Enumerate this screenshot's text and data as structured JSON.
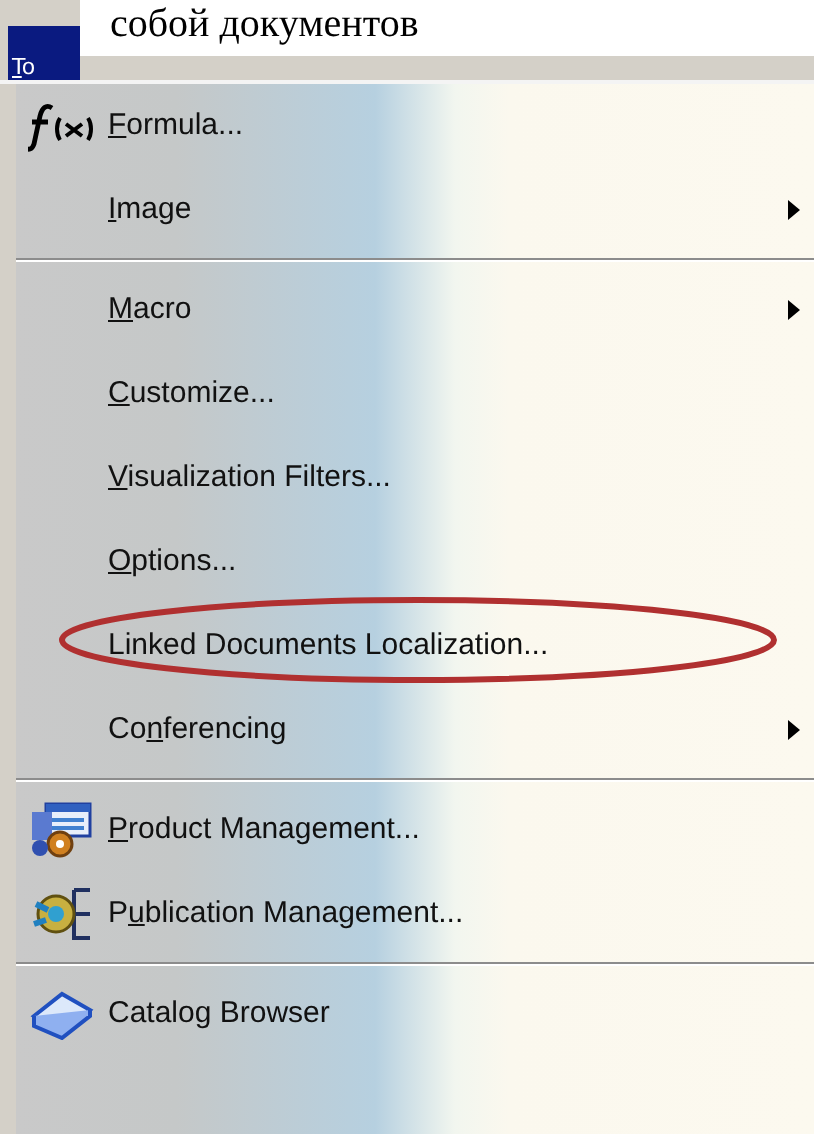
{
  "caption": "собой документов",
  "menu_bar": {
    "title": {
      "key": "T",
      "post": "o"
    },
    "open": true
  },
  "menu_items": [
    {
      "kind": "item",
      "key": "F",
      "post": "ormula...",
      "submenu": false,
      "highlighted": false
    },
    {
      "kind": "item",
      "key": "I",
      "post": "mage",
      "submenu": true,
      "highlighted": false
    },
    {
      "kind": "separator"
    },
    {
      "kind": "item",
      "key": "M",
      "post": "acro",
      "submenu": true,
      "highlighted": false
    },
    {
      "kind": "item",
      "key": "C",
      "post": "ustomize...",
      "submenu": false,
      "highlighted": false
    },
    {
      "kind": "item",
      "key": "V",
      "post": "isualization Filters...",
      "submenu": false,
      "highlighted": false
    },
    {
      "kind": "item",
      "key": "O",
      "post": "ptions...",
      "submenu": false,
      "highlighted": false
    },
    {
      "kind": "item",
      "pre": "Linked Documents Localization...",
      "submenu": false,
      "highlighted": true
    },
    {
      "kind": "item",
      "pre": "Co",
      "key": "n",
      "post": "ferencing",
      "submenu": true,
      "highlighted": false
    },
    {
      "kind": "separator"
    },
    {
      "kind": "item",
      "key": "P",
      "post": "roduct Management...",
      "submenu": false,
      "highlighted": false
    },
    {
      "kind": "item",
      "pre": "P",
      "key": "u",
      "post": "blication Management...",
      "submenu": false,
      "highlighted": false
    },
    {
      "kind": "separator"
    },
    {
      "kind": "item",
      "pre": "Catalog Browser",
      "submenu": false,
      "highlighted": false
    }
  ]
}
